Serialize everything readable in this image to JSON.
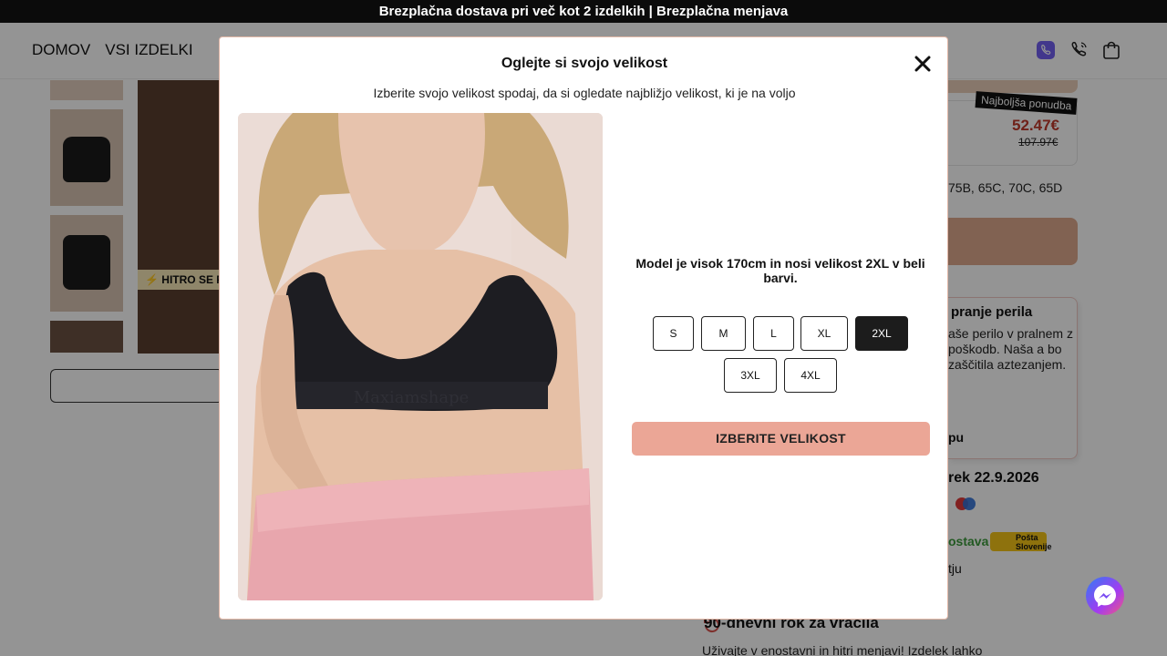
{
  "announcement": "Brezplačna dostava pri več kot 2 izdelkih | Brezplačna menjava",
  "nav": {
    "home": "DOMOV",
    "all_products": "VSI IZDELKI"
  },
  "background": {
    "hitro_label": "HITRO SE P",
    "best_offer_badge": "Najboljša ponudba",
    "price_new": "52.47€",
    "price_old": "107.97€",
    "sizes_text": "75B, 65C, 70C, 65D",
    "care_title": "pranje perila",
    "care_body": "aše perilo v pralnem z poškodb. Naša a bo zaščitila aztezanjem.",
    "care_footer": "pu",
    "delivery_date": "rek 22.9.2026",
    "shipping_label": "ostava",
    "posta_label": "Pošta Slovenije",
    "tju_text": "tju",
    "return_title": "90-dnevni rok za vračila",
    "return_body": "Uživajte v enostavni in hitri menjavi! Izdelek lahko"
  },
  "modal": {
    "title": "Oglejte si svojo velikost",
    "subtitle": "Izberite svojo velikost spodaj, da si ogledate najbližjo velikost, ki je na voljo",
    "model_text": "Model je visok 170cm in nosi velikost 2XL v beli barvi.",
    "photo_print": "Maxiamshape",
    "sizes": [
      "S",
      "M",
      "L",
      "XL",
      "2XL",
      "3XL",
      "4XL"
    ],
    "selected_size": "2XL",
    "select_button": "IZBERITE VELIKOST"
  },
  "colors": {
    "accent": "#eba696",
    "selected": "#1c1c1c",
    "price_red": "#c0392b"
  }
}
